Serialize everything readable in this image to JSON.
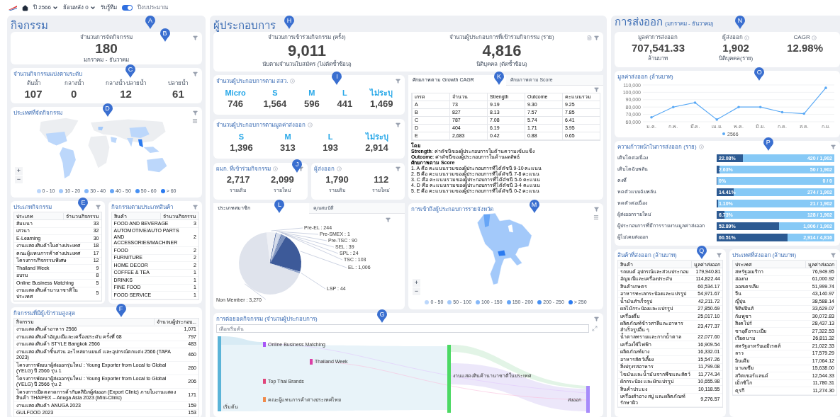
{
  "top_bar": {
    "year_filter": "ปี 2566",
    "lookback_filter": "ย้อนหลัง 0",
    "toggle_label": "รับรู้ทีม",
    "toggle_on": true,
    "toggle_text": "ปีงบประมาณ"
  },
  "activities": {
    "title": "กิจกรรม",
    "marker": "A",
    "total": {
      "marker": "B",
      "label": "จำนวนการจัดกิจกรรม",
      "value": "180",
      "period": "มกราคม - ธันวาคม"
    },
    "levels": {
      "marker": "C",
      "title": "จำนวนกิจกรรมแบ่งตามระดับ",
      "items": [
        {
          "label": "ต้นน้ำ",
          "value": "107"
        },
        {
          "label": "กลางน้ำ",
          "value": "0"
        },
        {
          "label": "กลางน้ำ-ปลายน้ำ",
          "value": "12"
        },
        {
          "label": "ปลายน้ำ",
          "value": "61"
        }
      ]
    },
    "country_map": {
      "marker": "D",
      "title": "ประเทศที่จัดกิจกรรม",
      "zoom_in": "+",
      "zoom_out": "−",
      "legend": [
        {
          "label": "0 - 10",
          "color": "#bcd7fb"
        },
        {
          "label": "10 - 20",
          "color": "#a3c9fa"
        },
        {
          "label": "30 - 40",
          "color": "#86b8f8"
        },
        {
          "label": "40 - 50",
          "color": "#66a5f6"
        },
        {
          "label": "50 - 60",
          "color": "#4690f3"
        },
        {
          "label": "> 60",
          "color": "#2a7af0"
        }
      ]
    },
    "type_table": {
      "marker": "E",
      "title": "ประเภทกิจกรรม",
      "columns": [
        "ประเภท",
        "จำนวนกิจกรรม"
      ],
      "rows": [
        [
          "สัมมนา",
          "33"
        ],
        [
          "เสวนา",
          "32"
        ],
        [
          "E-Learning",
          "30"
        ],
        [
          "งานแสดงสินค้าในต่างประเทศ",
          "18"
        ],
        [
          "คณะผู้แทนการค้าต่างประเทศ",
          "17"
        ],
        [
          "โครงการ/กิจกรรมพิเศษ",
          "12"
        ],
        [
          "Thailand Week",
          "9"
        ],
        [
          "อบรม",
          "8"
        ],
        [
          "Online Business Matching",
          "5"
        ],
        [
          "งานแสดงสินค้านานาชาติในประเทศ",
          "5"
        ]
      ]
    },
    "product_table": {
      "title": "กิจกรรมตามประเภทสินค้า",
      "columns": [
        "สินค้า",
        "จำนวนกิจกรรม"
      ],
      "rows": [
        [
          "FOOD AND BEVERAGE",
          "3"
        ],
        [
          "AUTOMOTIVE/AUTO PARTS AND ACCESSORIES/MACHINER",
          "2"
        ],
        [
          "FOOD",
          "2"
        ],
        [
          "FURNITURE",
          "2"
        ],
        [
          "HOME DECOR",
          "2"
        ],
        [
          "COFFEE & TEA",
          "1"
        ],
        [
          "DRINKS",
          "1"
        ],
        [
          "FINE FOOD",
          "1"
        ],
        [
          "FOOD SERVICE",
          "1"
        ]
      ]
    },
    "top_table": {
      "marker": "F",
      "title": "กิจกรรมที่มีผู้เข้าร่วมสูงสุด",
      "columns": [
        "กิจกรรม",
        "จำนวนผู้ประกอบ..."
      ],
      "rows": [
        [
          "งานแสดงสินค้าอาหาร 2566",
          "1,071"
        ],
        [
          "งานแสดงสินค้าอัญมณีและเครื่องประดับ ครั้งที่ 68",
          "797"
        ],
        [
          "งานแสดงสินค้า STYLE Bangkok 2566",
          "483"
        ],
        [
          "งานแสดงสินค้าชิ้นส่วน อะไหล่ยานยนต์ และอุปกรณ์ตกแต่ง 2566 (TAPA 2023)",
          "460"
        ],
        [
          "โครงการพัฒนาผู้ส่งออกรุ่นใหม่ : Young Exporter from Local to Global (YELG) ปี 2566 รุ่น 1",
          "260"
        ],
        [
          "โครงการพัฒนาผู้ส่งออกรุ่นใหม่ : Young Exporter from Local to Global (YELG) ปี 2566 รุ่น 2",
          "206"
        ],
        [
          "โครงการเปิดตลาดการค้ากับคลินิกผู้ส่งออก (Export Clinic) ภายในงานแสดงสินค้า THAIFEX – Anuga Asia 2023 (Mini-Clinic)",
          "171"
        ],
        [
          "งานแสดงสินค้า ANUGA 2023",
          "159"
        ],
        [
          "GULFOOD 2023",
          "153"
        ]
      ]
    }
  },
  "operators": {
    "title": "ผู้ประกอบการ",
    "marker": "H",
    "participation": [
      {
        "label": "จำนวนการเข้าร่วมกิจกรรม (ครั้ง)",
        "value": "9,011",
        "note": "นับตามจำนวนใบสมัคร (ไม่ตัดซ้ำซ้อน)"
      },
      {
        "label": "จำนวนผู้ประกอบการที่เข้าร่วมกิจกรรม (ราย)",
        "value": "4,816",
        "note": "นิติบุคคล (ตัดซ้ำซ้อน)"
      }
    ],
    "sme": {
      "marker": "I",
      "title": "จำนวนผู้ประกอบการตาม สสว.",
      "items": [
        {
          "label": "Micro",
          "value": "746"
        },
        {
          "label": "S",
          "value": "1,564"
        },
        {
          "label": "M",
          "value": "596"
        },
        {
          "label": "L",
          "value": "441"
        },
        {
          "label": "ไม่ระบุ",
          "value": "1,469"
        }
      ]
    },
    "export_size": {
      "title": "จำนวนผู้ประกอบการตามมูลค่าส่งออก",
      "items": [
        {
          "label": "S",
          "value": "1,396"
        },
        {
          "label": "M",
          "value": "313"
        },
        {
          "label": "L",
          "value": "193"
        },
        {
          "label": "ไม่ระบุ",
          "value": "2,914"
        }
      ]
    },
    "small_cards": [
      {
        "marker": "J",
        "title": "ผมก. ที่เข้าร่วมกิจกรรม",
        "items": [
          {
            "value": "2,717",
            "label": "รายเดิม"
          },
          {
            "value": "2,099",
            "label": "รายใหม่"
          }
        ]
      },
      {
        "title": "ผู้ส่งออก",
        "items": [
          {
            "value": "1,790",
            "label": "รายเดิม"
          },
          {
            "value": "112",
            "label": "รายใหม่"
          }
        ]
      }
    ],
    "grades": {
      "marker": "K",
      "tabs": [
        {
          "label": "ศักยภาพตาม Growth CAGR",
          "selected": true
        },
        {
          "label": "ศักยภาพตาม Score",
          "selected": false
        }
      ],
      "columns": [
        "เกรด",
        "จำนวน",
        "Strength",
        "Outcome",
        "คะแนนรวม"
      ],
      "rows": [
        [
          "A",
          "73",
          "9.19",
          "9.30",
          "9.25"
        ],
        [
          "B",
          "827",
          "8.13",
          "7.57",
          "7.85"
        ],
        [
          "C",
          "787",
          "7.08",
          "5.74",
          "6.41"
        ],
        [
          "D",
          "404",
          "6.19",
          "1.71",
          "3.95"
        ],
        [
          "E",
          "2,683",
          "0.42",
          "0.88",
          "0.65"
        ]
      ],
      "notes": [
        {
          "kind": "heading",
          "text": "โดย"
        },
        {
          "kind": "line",
          "text": "**Strength**: ค่าดัชนีของผู้ประกอบการในด้านความเข้มแข็ง"
        },
        {
          "kind": "line",
          "text": "**Outcome**: ค่าดัชนีของผู้ประกอบการในด้านผลลัพธ์"
        },
        {
          "kind": "heading",
          "text": "ศักยภาพตาม Score"
        },
        {
          "kind": "line",
          "text": "1. A คือ คะแนนรวมของผู้ประกอบการที่ได้ดัชนี 9-10 คะแนน"
        },
        {
          "kind": "line",
          "text": "2. B คือ คะแนนรวมของผู้ประกอบการที่ได้ดัชนี 7-8 คะแนน"
        },
        {
          "kind": "line",
          "text": "3. C คือ คะแนนรวมของผู้ประกอบการที่ได้ดัชนี 5-6 คะแนน"
        },
        {
          "kind": "line",
          "text": "4. D คือ คะแนนรวมของผู้ประกอบการที่ได้ดัชนี 3-4 คะแนน"
        },
        {
          "kind": "line",
          "text": "5. E คือ คะแนนรวมของผู้ประกอบการที่ได้ดัชนี 0-2 คะแนน"
        }
      ]
    },
    "membership": {
      "marker": "L",
      "tabs": [
        {
          "label": "ประเภทสมาชิก",
          "selected": true
        },
        {
          "label": "คุณสมบัติ",
          "selected": false
        }
      ],
      "chart_data": {
        "type": "pie",
        "categories": [
          "Pre-EL",
          "Pre-SMEX",
          "Pre-TSC",
          "SEL",
          "SPL",
          "TSC",
          "EL",
          "LSP",
          "Non Member"
        ],
        "values": [
          244,
          1,
          90,
          39,
          24,
          103,
          1006,
          44,
          3270
        ],
        "value_labels": [
          "244",
          "1",
          "90",
          "39",
          "24",
          "103",
          "1,006",
          "44",
          "3,270"
        ]
      }
    },
    "province_map": {
      "marker": "M",
      "title": "การเข้าถึงผู้ประกอบการรายจังหวัด",
      "zoom_in": "+",
      "zoom_out": "−",
      "legend": [
        {
          "label": "0 - 50",
          "color": "#bcd7fb"
        },
        {
          "label": "50 - 100",
          "color": "#a3c9fa"
        },
        {
          "label": "100 - 150",
          "color": "#86b8f8"
        },
        {
          "label": "150 - 200",
          "color": "#66a5f6"
        },
        {
          "label": "200 - 250",
          "color": "#4690f3"
        },
        {
          "label": "> 250",
          "color": "#2a7af0"
        }
      ]
    },
    "sankey": {
      "marker": "G",
      "title": "การต่อยอดกิจกรรม (จำนวนผู้ประกอบการ)",
      "select_placeholder": "เลือกเริ่มต้น",
      "nodes": [
        {
          "label": "เริ่มต้น",
          "color": "#5bb4d8"
        },
        {
          "label": "Online Business Matching",
          "color": "#a855f7"
        },
        {
          "label": "Thailand Week",
          "color": "#db3fa6"
        },
        {
          "label": "Top Thai Brands",
          "color": "#e0457b"
        },
        {
          "label": "คณะผู้แทนการค้าต่างประเทศไทย",
          "color": "#f08a4b"
        },
        {
          "label": "งานแสดงสินค้านานาชาติในประเทศ",
          "color": "#4cd964"
        },
        {
          "label": "ส่งออก",
          "color": "#a78bfa"
        }
      ]
    }
  },
  "exports": {
    "title": "การส่งออก",
    "subtitle": "(มกราคม - ธันวาคม)",
    "marker": "N",
    "summary": [
      {
        "label": "มูลค่าการส่งออก",
        "value": "707,541.33",
        "unit": "ล้านบาท"
      },
      {
        "label": "ผู้ส่งออก",
        "value": "1,902",
        "unit": "นิติบุคคล(ราย)"
      },
      {
        "label": "CAGR",
        "value": "12.98%"
      }
    ],
    "trend": {
      "marker": "O",
      "title": "มูลค่าส่งออก (ล้านบาท)",
      "chart_data": {
        "type": "line",
        "categories": [
          "ม.ค.",
          "ก.พ.",
          "มี.ค.",
          "เม.ย.",
          "พ.ค.",
          "มิ.ย.",
          "ก.ค.",
          "ส.ค.",
          "ก.ย."
        ],
        "series": [
          {
            "name": "2566",
            "color": "#5aa9f5",
            "values": [
              66000,
              80000,
              86000,
              63000,
              80000,
              80000,
              73000,
              71000,
              106000
            ]
          }
        ],
        "ylim": [
          60000,
          110000
        ],
        "grid": true,
        "yticks": [
          {
            "value": 60000,
            "label": "60,000"
          },
          {
            "value": 70000,
            "label": "70,000"
          },
          {
            "value": 80000,
            "label": "80,000"
          },
          {
            "value": 90000,
            "label": "90,000"
          },
          {
            "value": 100000,
            "label": "100,000"
          },
          {
            "value": 110000,
            "label": "110,000"
          }
        ]
      }
    },
    "progress": {
      "marker": "P",
      "title": "ความก้าวหน้าในการส่งออก (ราย)",
      "rows": [
        {
          "label": "เติบโตต่อเนื่อง",
          "level": 0.2208,
          "percent": "22.08%",
          "count": "420 / 1,902"
        },
        {
          "label": "เติบโตฉับพลัน",
          "level": 0.0263,
          "percent": "2.63%",
          "count": "50 / 1,902"
        },
        {
          "label": "คงที่",
          "level": 0,
          "percent": "0%",
          "count": "0 / 0"
        },
        {
          "label": "หดตัวแบบฉับพลัน",
          "level": 0.1441,
          "percent": "14.41%",
          "count": "274 / 1,902"
        },
        {
          "label": "หดตัวต่อเนื่อง",
          "level": 0.011,
          "percent": "1.10%",
          "count": "21 / 1,902"
        },
        {
          "label": "ผู้ส่งออกรายใหม่",
          "level": 0.0673,
          "percent": "6.73%",
          "count": "128 / 1,902"
        },
        {
          "label": "ผู้ประกอบการที่มีการรายงานมูลค่าส่งออก",
          "level": 0.5289,
          "percent": "52.89%",
          "count": "1,006 / 1,902"
        },
        {
          "label": "ผู้ไม่เคยส่งออก",
          "level": 0.6051,
          "percent": "60.51%",
          "count": "2,914 / 4,816"
        }
      ]
    },
    "products": {
      "marker": "Q",
      "title": "สินค้าที่ส่งออก (ล้านบาท)",
      "columns": [
        "สินค้า",
        "มูลค่าส่งออก"
      ],
      "rows": [
        [
          "รถยนต์ อุปกรณ์และส่วนประกอบ",
          "179,940.81"
        ],
        [
          "อัญมณีและเครื่องประดับ",
          "114,822.44"
        ],
        [
          "สินค้าเกษตร",
          "60,534.17"
        ],
        [
          "อาหารทะเลกระป๋องและแปรรูป",
          "54,971.67"
        ],
        [
          "น้ำมันสำเร็จรูป",
          "42,211.72"
        ],
        [
          "ผลไม้กระป๋องและแปรรูป",
          "27,850.69"
        ],
        [
          "เครื่องดื่ม",
          "25,017.10"
        ],
        [
          "ผลิตภัณฑ์ข้าวสาลีและอาหารสำเร็จรูปอื่น ๆ",
          "23,477.37"
        ],
        [
          "น้ำตาลทรายและกากน้ำตาล",
          "22,077.60"
        ],
        [
          "เครื่องใช้ไฟฟ้า",
          "16,909.54"
        ],
        [
          "ผลิตภัณฑ์ยาง",
          "16,332.01"
        ],
        [
          "อาหารสัตว์เลี้ยง",
          "15,547.26"
        ],
        [
          "สิ่งปรุงรสอาหาร",
          "11,799.08"
        ],
        [
          "ไขมันและน้ำมันจากพืชและสัตว์",
          "11,774.34"
        ],
        [
          "ผักกระป๋อง และผักแปรรูป",
          "10,655.98"
        ],
        [
          "สินค้าประมง",
          "10,118.55"
        ],
        [
          "เครื่องสำอาง สบู่ และผลิตภัณฑ์รักษาผิว",
          "9,276.57"
        ]
      ]
    },
    "countries": {
      "title": "ประเทศที่ส่งออก (ล้านบาท)",
      "columns": [
        "ประเทศ",
        "มูลค่าส่งออก"
      ],
      "rows": [
        [
          "สหรัฐอเมริกา",
          "76,949.95"
        ],
        [
          "ฮ่องกง",
          "61,000.92"
        ],
        [
          "ออสเตรเลีย",
          "51,999.74"
        ],
        [
          "จีน",
          "43,140.97"
        ],
        [
          "ญี่ปุ่น",
          "38,588.14"
        ],
        [
          "ฟิลิปปินส์",
          "33,629.07"
        ],
        [
          "กัมพูชา",
          "30,072.83"
        ],
        [
          "สิงคโปร์",
          "28,437.13"
        ],
        [
          "ซาอุดีอาระเบีย",
          "27,322.53"
        ],
        [
          "เวียดนาม",
          "26,811.32"
        ],
        [
          "สหรัฐอาหรับเอมิเรตส์",
          "21,022.33"
        ],
        [
          "ลาว",
          "17,579.29"
        ],
        [
          "อินเดีย",
          "17,064.12"
        ],
        [
          "มาเลเซีย",
          "15,638.00"
        ],
        [
          "สวิตเซอร์แลนด์",
          "12,544.33"
        ],
        [
          "เม็กซิโก",
          "11,780.31"
        ],
        [
          "ตุรกี",
          "11,274.30"
        ]
      ]
    }
  }
}
